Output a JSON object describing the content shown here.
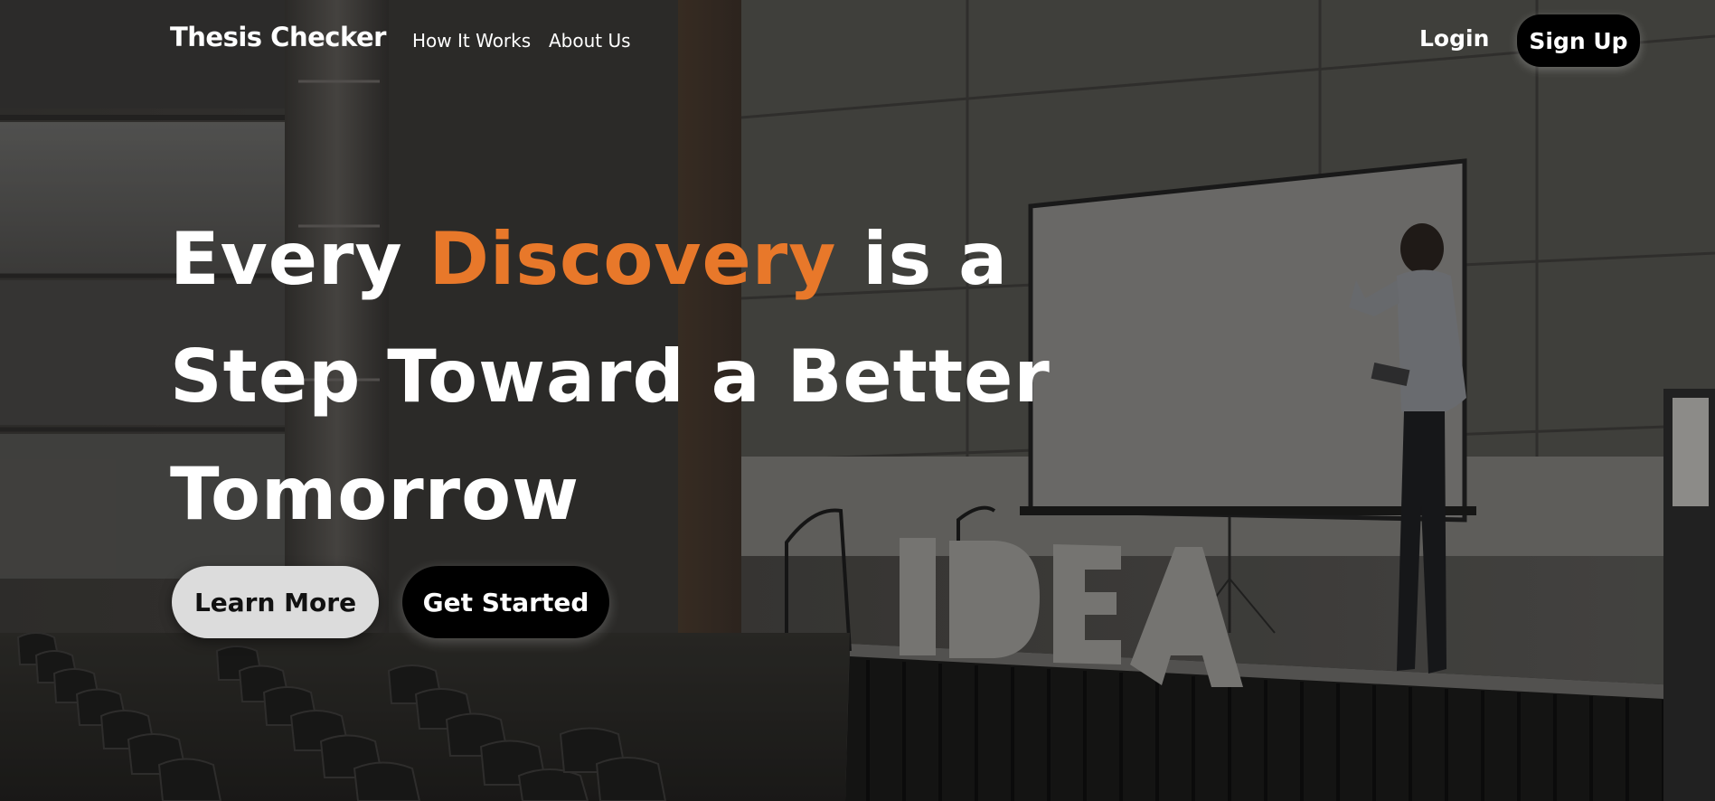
{
  "nav": {
    "brand": "Thesis Checker",
    "links": [
      {
        "label": "How It Works"
      },
      {
        "label": "About Us"
      }
    ],
    "login_label": "Login",
    "signup_label": "Sign Up"
  },
  "hero": {
    "title_part1": "Every ",
    "title_accent": "Discovery",
    "title_part2": " is a",
    "title_line2": "Step Toward a Better",
    "title_line3": "Tomorrow",
    "learn_more_label": "Learn More",
    "get_started_label": "Get Started"
  },
  "background": {
    "sign_text": "IDEA"
  },
  "colors": {
    "accent": "#e8782a",
    "button_dark": "#000000",
    "button_light": "#dcdcdc"
  }
}
